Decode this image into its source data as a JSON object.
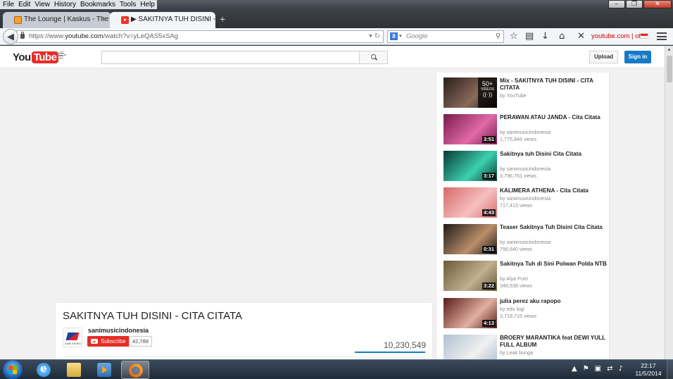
{
  "menu": [
    "File",
    "Edit",
    "View",
    "History",
    "Bookmarks",
    "Tools",
    "Help"
  ],
  "tabs": [
    {
      "title": "The Lounge | Kaskus - The ...",
      "close": "×"
    },
    {
      "title": "▶ SAKITNYA TUH DISINI - ...",
      "close": "×"
    }
  ],
  "newtab": "+",
  "address": {
    "prefix": "https://www.",
    "domain": "youtube.com",
    "path": "/watch?v=yLeQAS5xSAg"
  },
  "searchbox": {
    "placeholder": "Google",
    "engine_letter": "8"
  },
  "extension": {
    "label": "youtube.com | off"
  },
  "yt": {
    "logo_you": "You",
    "logo_tube": "Tube",
    "logo_country": "ID",
    "upload": "Upload",
    "signin": "Sign in"
  },
  "video": {
    "title": "SAKITNYA TUH DISINI - CITA CITATA",
    "channel": "sanimusicindonesia",
    "channel_logo_caption": "SANI MUSIC",
    "subscribe": "Subscribe",
    "subscribers": "42,788",
    "views": "10,230,549"
  },
  "related": [
    {
      "title": "Mix - SAKITNYA TUH DISINI - CITA CITATA",
      "by": "by YouTube",
      "views": "",
      "duration": "",
      "mix": true,
      "mix_count": "50+",
      "mix_label": "VIDEOS",
      "thumb": [
        "#2a1e1a",
        "#8a6a5a"
      ]
    },
    {
      "title": "PERAWAN ATAU JANDA - Cita Citata",
      "by": "by sanimusicindonesia",
      "views": "1,775,846 views",
      "duration": "3:51",
      "thumb": [
        "#7a1a4a",
        "#e06aa8"
      ]
    },
    {
      "title": "Sakitnya tuh Disini Cita Citata",
      "by": "by sanimusicindonesia",
      "views": "3,796,761 views",
      "duration": "3:17",
      "thumb": [
        "#0a3a34",
        "#3ad0b0"
      ]
    },
    {
      "title": "KALIMERA ATHENA - Cita Citata",
      "by": "by sanimusicindonesia",
      "views": "717,413 views",
      "duration": "4:43",
      "thumb": [
        "#d86a6a",
        "#f6c0c0"
      ]
    },
    {
      "title": "Teaser Sakitnya Tuh Disini Cita Citata",
      "by": "by sanimusicindonesia",
      "views": "796,640 views",
      "duration": "0:31",
      "thumb": [
        "#1e1a18",
        "#b98e6a"
      ]
    },
    {
      "title": "Sakitnya Tuh di Sini Polwan Polda NTB",
      "by": "by Alya Putri",
      "views": "346,538 views",
      "duration": "3:22",
      "thumb": [
        "#6a5a3a",
        "#c0b090"
      ]
    },
    {
      "title": "julia perez aku rapopo",
      "by": "by edo logi",
      "views": "3,719,715 views",
      "duration": "4:13",
      "thumb": [
        "#5a1a1a",
        "#e0b0a0"
      ]
    },
    {
      "title": "BROERY MARANTIKA feat DEWI YULL FULL ALBUM",
      "by": "by Leak bunga",
      "views": "",
      "duration": "",
      "thumb": [
        "#b0c0d0",
        "#f0f0f0"
      ]
    }
  ],
  "clock": {
    "time": "22:17",
    "date": "11/5/2014"
  }
}
